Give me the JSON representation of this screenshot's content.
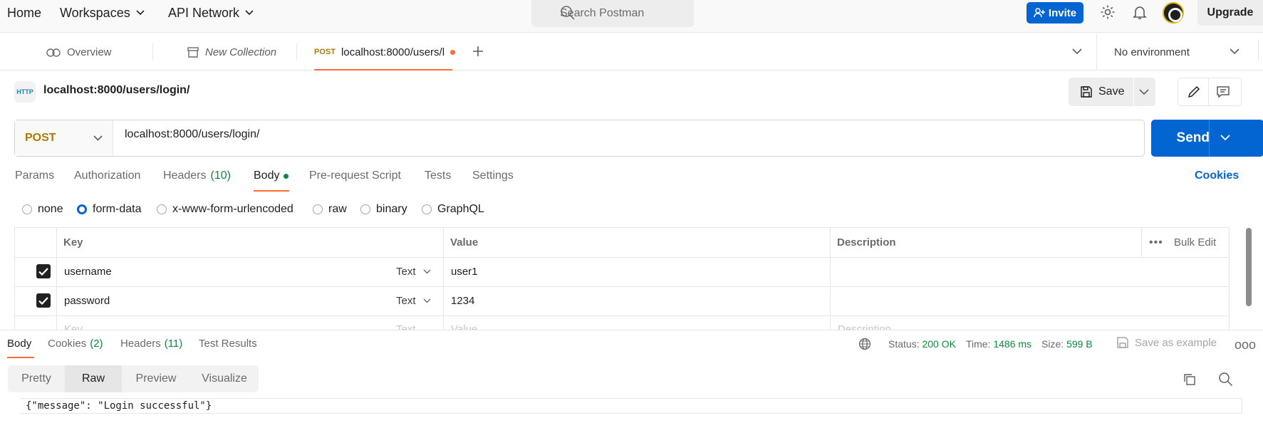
{
  "topbar": {
    "home": "Home",
    "workspaces": "Workspaces",
    "api_network": "API Network",
    "search_placeholder": "Search Postman",
    "invite": "Invite",
    "upgrade": "Upgrade"
  },
  "tabs": {
    "overview": "Overview",
    "new_collection": "New Collection",
    "active_method": "POST",
    "active_title": "localhost:8000/users/l",
    "environment": "No environment"
  },
  "request": {
    "http_badge": "HTTP",
    "title": "localhost:8000/users/login/",
    "save": "Save",
    "method": "POST",
    "url": "localhost:8000/users/login/",
    "send": "Send"
  },
  "request_tabs": {
    "params": "Params",
    "authorization": "Authorization",
    "headers": "Headers",
    "headers_count": "(10)",
    "body": "Body",
    "pre_request": "Pre-request Script",
    "tests": "Tests",
    "settings": "Settings",
    "cookies": "Cookies"
  },
  "body_types": [
    "none",
    "form-data",
    "x-www-form-urlencoded",
    "raw",
    "binary",
    "GraphQL"
  ],
  "body_type_selected": "form-data",
  "params_table": {
    "headers": {
      "key": "Key",
      "value": "Value",
      "description": "Description",
      "bulk_edit": "Bulk Edit"
    },
    "rows": [
      {
        "key": "username",
        "type": "Text",
        "value": "user1",
        "checked": true
      },
      {
        "key": "password",
        "type": "Text",
        "value": "1234",
        "checked": true
      }
    ],
    "placeholder": {
      "key": "Key",
      "type": "Text",
      "value": "Value",
      "description": "Description"
    }
  },
  "response": {
    "tabs": {
      "body": "Body",
      "cookies": "Cookies",
      "cookies_count": "(2)",
      "headers": "Headers",
      "headers_count": "(11)",
      "test_results": "Test Results"
    },
    "status_label": "Status:",
    "status": "200 OK",
    "time_label": "Time:",
    "time": "1486 ms",
    "size_label": "Size:",
    "size": "599 B",
    "save_as_example": "Save as example",
    "views": [
      "Pretty",
      "Raw",
      "Preview",
      "Visualize"
    ],
    "selected_view": "Raw",
    "raw_body": "{\"message\": \"Login successful\"}"
  },
  "colors": {
    "accent": "#ff6c37",
    "primary": "#0265d2",
    "method_post": "#ad7a03",
    "success": "#0a8a3c"
  }
}
